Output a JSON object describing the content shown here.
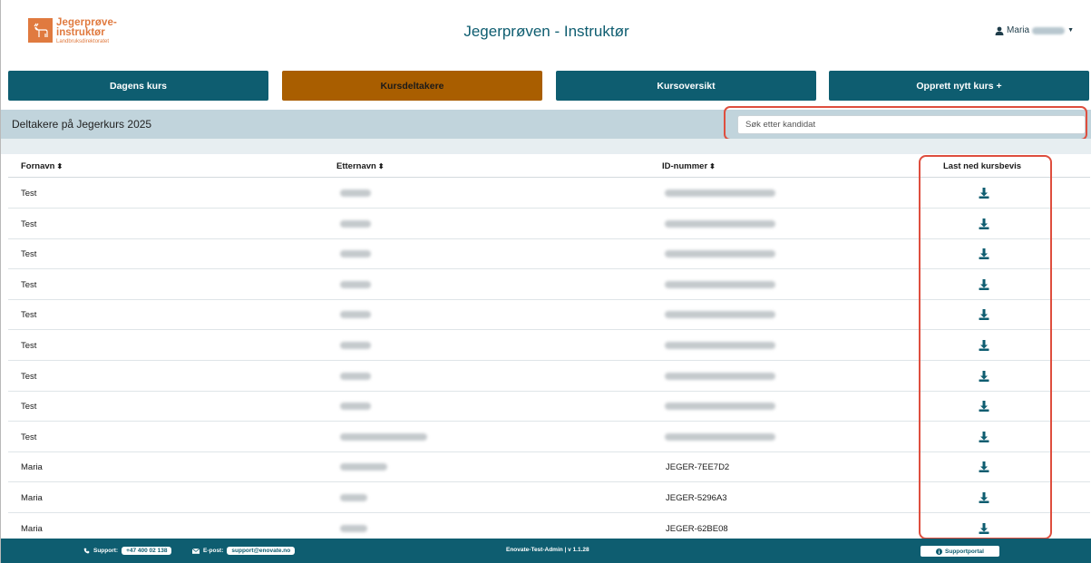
{
  "header": {
    "logo_line1": "Jegerprøve-",
    "logo_line2": "instruktør",
    "logo_line3": "Landbruksdirektoratet",
    "app_title": "Jegerprøven - Instruktør",
    "user_name": "Maria"
  },
  "nav": [
    {
      "label": "Dagens kurs",
      "active": false
    },
    {
      "label": "Kursdeltakere",
      "active": true
    },
    {
      "label": "Kursoversikt",
      "active": false
    },
    {
      "label": "Opprett nytt kurs +",
      "active": false
    }
  ],
  "subheader": {
    "title": "Deltakere på Jegerkurs 2025",
    "search_placeholder": "Søk etter kandidat"
  },
  "table": {
    "columns": [
      "Fornavn",
      "Etternavn",
      "ID-nummer",
      "Last ned kursbevis"
    ],
    "rows": [
      {
        "first": "Test",
        "last_redacted": true,
        "id": "",
        "id_redacted": true
      },
      {
        "first": "Test",
        "last_redacted": true,
        "id": "",
        "id_redacted": true
      },
      {
        "first": "Test",
        "last_redacted": true,
        "id": "",
        "id_redacted": true
      },
      {
        "first": "Test",
        "last_redacted": true,
        "id": "",
        "id_redacted": true
      },
      {
        "first": "Test",
        "last_redacted": true,
        "id": "",
        "id_redacted": true
      },
      {
        "first": "Test",
        "last_redacted": true,
        "id": "",
        "id_redacted": true
      },
      {
        "first": "Test",
        "last_redacted": true,
        "id": "",
        "id_redacted": true
      },
      {
        "first": "Test",
        "last_redacted": true,
        "id": "",
        "id_redacted": true
      },
      {
        "first": "Test",
        "last_redacted": true,
        "id": "",
        "id_redacted": true
      },
      {
        "first": "Maria",
        "last_redacted": true,
        "id": "JEGER-7EE7D2",
        "id_redacted": false
      },
      {
        "first": "Maria",
        "last_redacted": true,
        "id": "JEGER-5296A3",
        "id_redacted": false
      },
      {
        "first": "Maria",
        "last_redacted": true,
        "id": "JEGER-62BE08",
        "id_redacted": false
      }
    ]
  },
  "footer": {
    "support_label": "Support:",
    "support_phone": "+47 400 02 138",
    "email_label": "E-post:",
    "email": "support@enovate.no",
    "version": "Enovate-Test-Admin | v 1.1.28",
    "portal_button": "Supportportal"
  },
  "colors": {
    "primary": "#0e5d70",
    "active_tab": "#a95e00",
    "highlight": "#de4e3e",
    "logo": "#e07a3f"
  },
  "icons": [
    "user-icon",
    "sort-icon",
    "download-icon",
    "phone-icon",
    "mail-icon",
    "info-icon"
  ]
}
